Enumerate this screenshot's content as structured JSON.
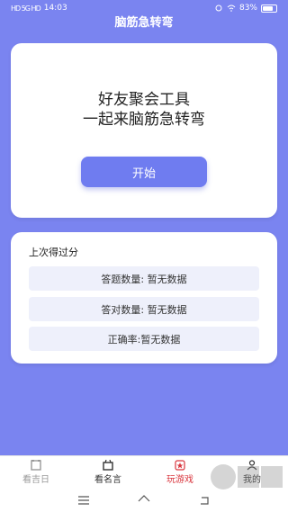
{
  "status_bar": {
    "carrier_icons": "HD 5G HD",
    "time": "14:03",
    "battery": "83%"
  },
  "header": {
    "title": "脑筋急转弯"
  },
  "hero": {
    "slogan_line1": "好友聚会工具",
    "slogan_line2": "一起来脑筋急转弯",
    "start_label": "开始"
  },
  "last_score": {
    "title": "上次得过分",
    "rows": [
      {
        "text": "答题数量: 暂无数据"
      },
      {
        "text": "答对数量: 暂无数据"
      },
      {
        "text": "正确率:暂无数据"
      }
    ]
  },
  "bottom_nav": {
    "items": [
      {
        "label": "看吉日",
        "icon": "calendar-icon",
        "state": "inactive"
      },
      {
        "label": "看名言",
        "icon": "quote-box-icon",
        "state": "dark"
      },
      {
        "label": "玩游戏",
        "icon": "game-star-icon",
        "state": "active"
      },
      {
        "label": "我的",
        "icon": "user-icon",
        "state": "dark"
      }
    ]
  },
  "colors": {
    "background": "#7a84f0",
    "accent": "#6f7cf0",
    "active_nav": "#d9363e"
  }
}
